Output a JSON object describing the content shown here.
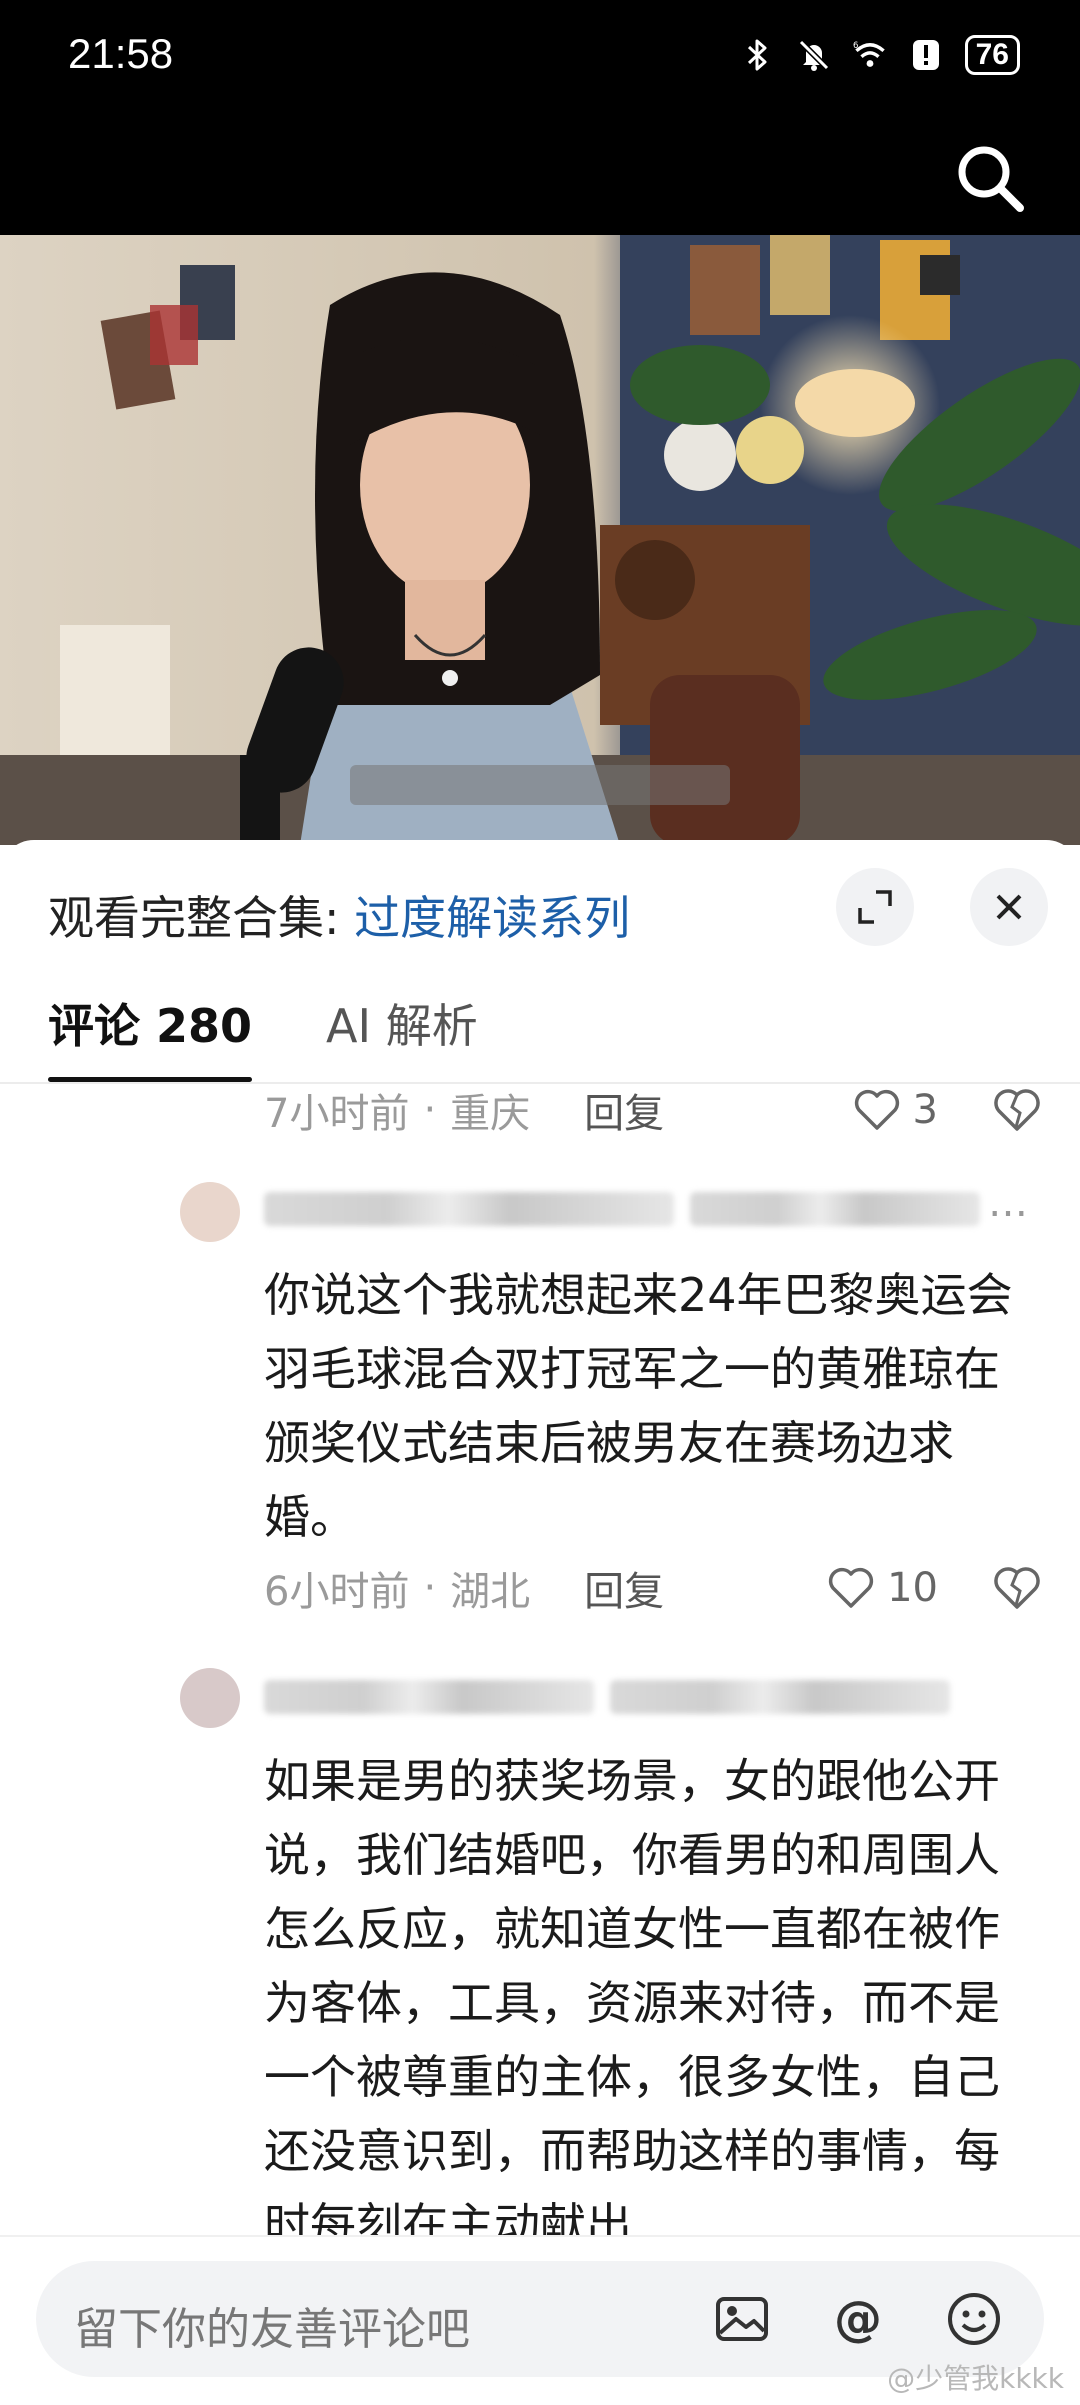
{
  "status_bar": {
    "time": "21:58",
    "battery": "76",
    "icons": [
      "bluetooth-icon",
      "mute-icon",
      "wifi-6-icon",
      "alert-icon",
      "battery-icon"
    ]
  },
  "top_bar": {
    "search_icon": "search-icon"
  },
  "sheet": {
    "title_prefix": "观看完整合集: ",
    "title_link": "过度解读系列",
    "expand_icon": "expand-icon",
    "close_icon": "close-icon",
    "tabs": [
      {
        "label": "评论 280",
        "active": true
      },
      {
        "label": "AI 解析",
        "active": false
      }
    ]
  },
  "comments": [
    {
      "time_ago": "7小时前",
      "location": "重庆",
      "reply_label": "回复",
      "likes": "3"
    },
    {
      "text": "你说这个我就想起来24年巴黎奥运会羽毛球混合双打冠军之一的黄雅琼在颁奖仪式结束后被男友在赛场边求婚。",
      "time_ago": "6小时前",
      "location": "湖北",
      "reply_label": "回复",
      "likes": "10",
      "name_suffix": "…"
    },
    {
      "text": "如果是男的获奖场景，女的跟他公开说，我们结婚吧，你看男的和周围人怎么反应，就知道女性一直都在被作为客体，工具，资源来对待，而不是一个被尊重的主体，很多女性，自己还没意识到，而帮助这样的事情，每时每刻在主动献出"
    }
  ],
  "comment_input": {
    "placeholder": "留下你的友善评论吧",
    "icons": [
      "image-icon",
      "at-icon",
      "emoji-icon"
    ]
  },
  "watermark": "@少管我kkkk",
  "colors": {
    "link": "#1d5fa8",
    "statusbar_bg": "#000000",
    "sheet_bg": "#ffffff"
  }
}
